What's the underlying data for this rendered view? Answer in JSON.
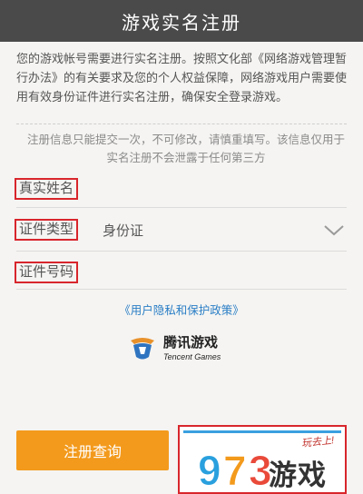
{
  "header": {
    "title": "游戏实名注册"
  },
  "intro": "您的游戏帐号需要进行实名注册。按照文化部《网络游戏管理暂行办法》的有关要求及您的个人权益保障，网络游戏用户需要使用有效身份证件进行实名注册，确保安全登录游戏。",
  "notice": "注册信息只能提交一次，不可修改，请慎重填写。该信息仅用于实名注册不会泄露于任何第三方",
  "form": {
    "real_name_label": "真实姓名",
    "id_type_label": "证件类型",
    "id_type_value": "身份证",
    "id_number_label": "证件号码"
  },
  "policy_link": "《用户隐私和保护政策》",
  "logo": {
    "cn": "腾讯游戏",
    "en": "Tencent Games"
  },
  "buttons": {
    "query": "注册查询"
  },
  "watermark": {
    "digits": "973",
    "cn": "游戏",
    "slogan": "玩去上!"
  },
  "colors": {
    "header_bg": "#4a4a4a",
    "accent_orange": "#f39a1c",
    "highlight_red": "#d8262c",
    "link_blue": "#2a7ec6"
  }
}
